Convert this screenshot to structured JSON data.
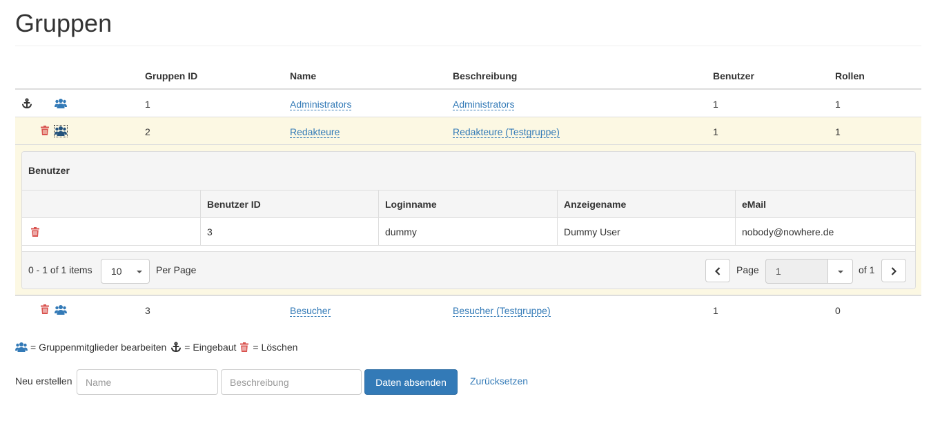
{
  "page": {
    "title": "Gruppen"
  },
  "colors": {
    "link": "#337ab7",
    "danger": "#d9534f",
    "active_row": "#fcf8e3",
    "primary": "#337ab7"
  },
  "table": {
    "headers": {
      "id": "Gruppen ID",
      "name": "Name",
      "description": "Beschreibung",
      "users": "Benutzer",
      "roles": "Rollen"
    },
    "rows": [
      {
        "id": "1",
        "name": "Administrators",
        "description": "Administrators",
        "users": "1",
        "roles": "1",
        "icons": [
          "anchor-icon",
          "users-icon"
        ]
      },
      {
        "id": "2",
        "name": "Redakteure",
        "description": "Redakteure (Testgruppe)",
        "users": "1",
        "roles": "1",
        "icons": [
          "trash-icon",
          "users-icon"
        ],
        "active": true
      },
      {
        "id": "3",
        "name": "Besucher",
        "description": "Besucher (Testgruppe)",
        "users": "1",
        "roles": "0",
        "icons": [
          "trash-icon",
          "users-icon"
        ]
      }
    ]
  },
  "members_panel": {
    "title": "Benutzer",
    "headers": {
      "user_id": "Benutzer ID",
      "login": "Loginname",
      "display_name": "Anzeigename",
      "email": "eMail"
    },
    "rows": [
      {
        "user_id": "3",
        "login": "dummy",
        "display_name": "Dummy User",
        "email": "nobody@nowhere.de"
      }
    ],
    "pager": {
      "info": "0 - 1 of 1 items",
      "page_size": "10",
      "per_page_label": "Per Page",
      "page_label": "Page",
      "current_page": "1",
      "of_label": "of 1"
    }
  },
  "legend": {
    "edit_members": "= Gruppenmitglieder bearbeiten",
    "builtin": "= Eingebaut",
    "delete": "= Löschen"
  },
  "new_form": {
    "label": "Neu erstellen",
    "name_placeholder": "Name",
    "description_placeholder": "Beschreibung",
    "submit_label": "Daten absenden",
    "reset_label": "Zurücksetzen"
  }
}
